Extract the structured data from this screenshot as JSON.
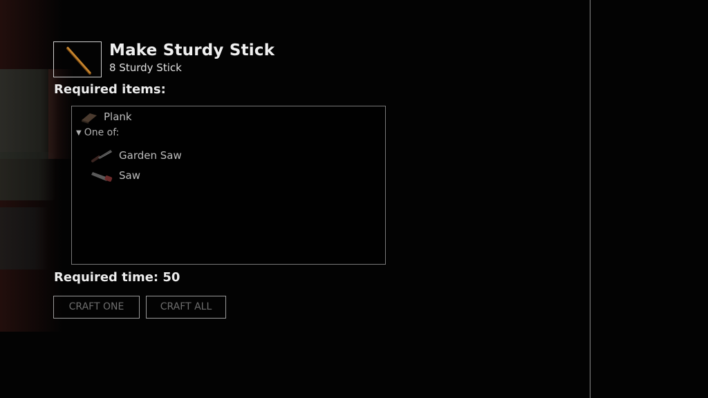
{
  "recipe": {
    "title": "Make Sturdy Stick",
    "result": "8 Sturdy Stick",
    "result_icon": "sturdy-stick-icon"
  },
  "required_items": {
    "label": "Required items:",
    "items": [
      {
        "name": "Plank",
        "icon": "plank-icon"
      }
    ],
    "one_of": {
      "label": "One of:",
      "items": [
        {
          "name": "Garden Saw",
          "icon": "garden-saw-icon"
        },
        {
          "name": "Saw",
          "icon": "saw-icon"
        }
      ]
    }
  },
  "required_time": {
    "label": "Required time:",
    "value": "50"
  },
  "buttons": {
    "craft_one": "CRAFT ONE",
    "craft_all": "CRAFT ALL"
  },
  "colors": {
    "background": "#030303",
    "text": "#e6e6e6",
    "disabled_button_text": "#6e6e6e",
    "stick": "#c8862e"
  }
}
